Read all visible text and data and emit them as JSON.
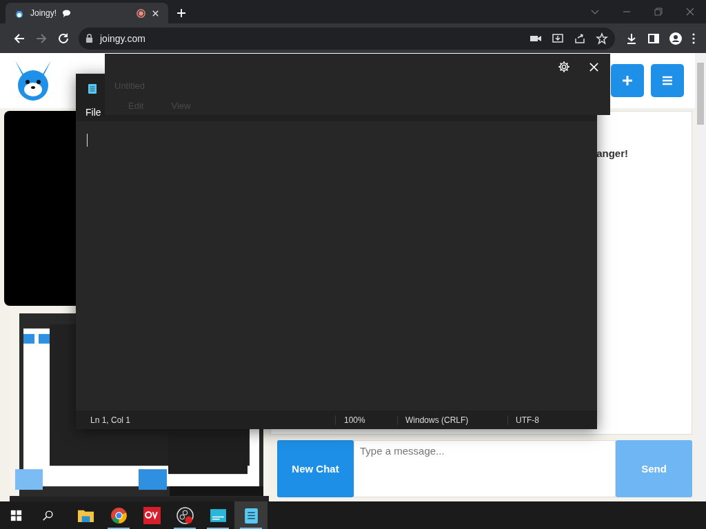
{
  "browser": {
    "tab": {
      "title": "Joingy!",
      "selected": true
    },
    "address": "joingy.com",
    "forward_disabled": true
  },
  "site": {
    "chat_text": "anger!",
    "new_chat": "New Chat",
    "message_placeholder": "Type a message...",
    "send": "Send",
    "send_disabled": true
  },
  "overlay": {
    "ghost_title": "Untitled",
    "ghost_menus": [
      "Edit",
      "View"
    ]
  },
  "notepad": {
    "menus": [
      "File"
    ],
    "status": [
      "Ln 1, Col 1",
      "100%",
      "Windows (CRLF)",
      "UTF-8"
    ]
  },
  "taskbar": {
    "apps": [
      {
        "kind": "explorer",
        "running": false,
        "active": false
      },
      {
        "kind": "chrome",
        "running": true,
        "active": false
      },
      {
        "kind": "red-app",
        "running": false,
        "active": false
      },
      {
        "kind": "recorder",
        "running": true,
        "active": false
      },
      {
        "kind": "teal-app",
        "running": true,
        "active": false
      },
      {
        "kind": "notepad",
        "running": true,
        "active": true
      }
    ]
  }
}
